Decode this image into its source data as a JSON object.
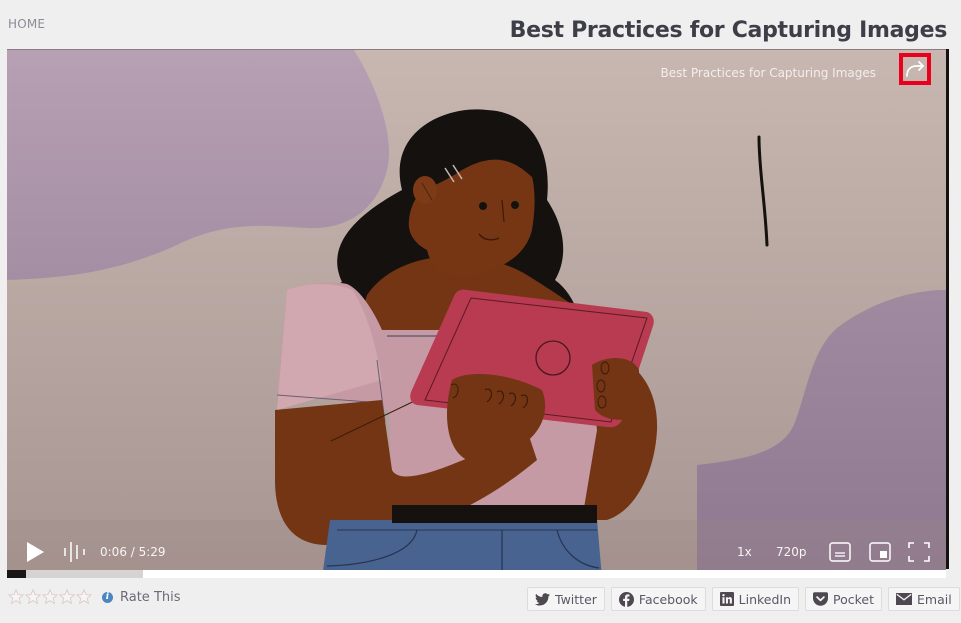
{
  "breadcrumb": {
    "home_label": "HOME"
  },
  "page": {
    "title": "Best Practices for Capturing Images"
  },
  "player": {
    "overlay_title": "Best Practices for Capturing Images",
    "share_icon": "share-arrow-icon",
    "controls": {
      "play_icon": "play-icon",
      "volume_icon": "audio-waveform-icon",
      "current_time": "0:06",
      "duration": "5:29",
      "time_display": "0:06 / 5:29",
      "speed": "1x",
      "quality": "720p",
      "captions_icon": "captions-icon",
      "pip_icon": "picture-in-picture-icon",
      "fullscreen_icon": "fullscreen-icon"
    },
    "progress": {
      "played_fraction": 0.02,
      "buffered_fraction": 0.145
    },
    "colors": {
      "highlight": "#e8001c",
      "played": "#1a1614",
      "buffered": "#d6d3d3"
    }
  },
  "rating": {
    "stars_total": 5,
    "stars_filled": 0,
    "info_icon": "info-icon",
    "label": "Rate This"
  },
  "share": {
    "buttons": [
      {
        "label": "Twitter",
        "icon": "twitter-icon"
      },
      {
        "label": "Facebook",
        "icon": "facebook-icon"
      },
      {
        "label": "LinkedIn",
        "icon": "linkedin-icon"
      },
      {
        "label": "Pocket",
        "icon": "pocket-icon"
      },
      {
        "label": "Email",
        "icon": "email-icon"
      }
    ]
  }
}
